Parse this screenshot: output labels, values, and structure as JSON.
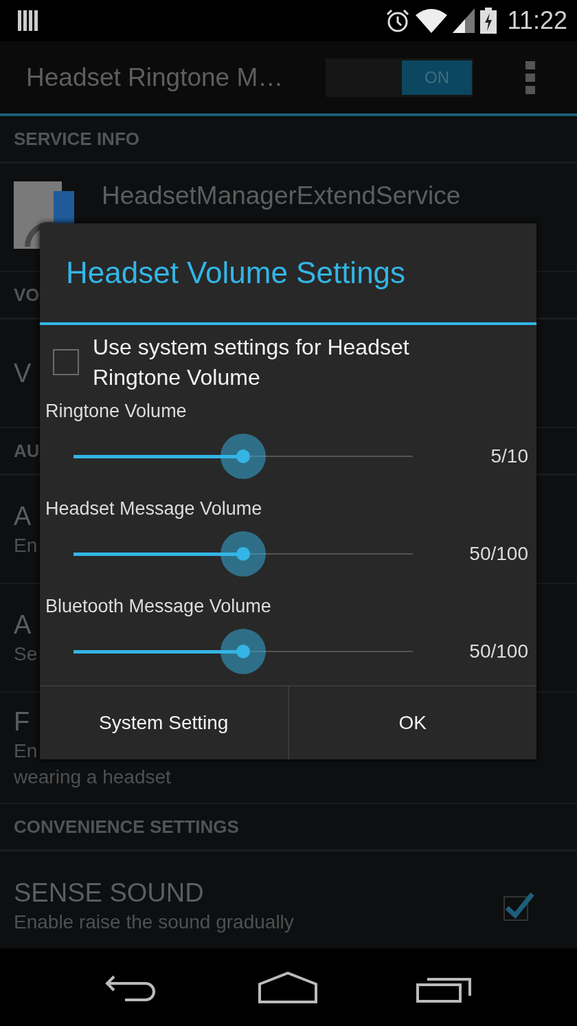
{
  "status_bar": {
    "time": "11:22"
  },
  "action_bar": {
    "title": "Headset Ringtone M…",
    "switch": {
      "label": "ON",
      "on": true
    }
  },
  "sections": [
    {
      "header": "SERVICE INFO",
      "items": [
        {
          "kind": "service",
          "title": "HeadsetManagerExtendService"
        }
      ]
    },
    {
      "header": "VO",
      "items": [
        {
          "kind": "plain",
          "title": "V"
        }
      ]
    },
    {
      "header": "AU",
      "items": [
        {
          "kind": "plain",
          "title": "A",
          "subtitle_lines": [
            "En"
          ]
        },
        {
          "kind": "plain",
          "title": "A",
          "subtitle_lines": [
            "Se"
          ]
        },
        {
          "kind": "plain",
          "title": "F",
          "subtitle_lines": [
            "En",
            "wearing a headset"
          ]
        }
      ]
    },
    {
      "header": "CONVENIENCE SETTINGS",
      "items": [
        {
          "kind": "check",
          "title": "SENSE SOUND",
          "subtitle_lines": [
            "Enable raise the sound gradually"
          ],
          "checked": true
        }
      ]
    }
  ],
  "dialog": {
    "title": "Headset Volume Settings",
    "checkbox": {
      "label": "Use system settings for Headset Ringtone Volume",
      "checked": false
    },
    "sliders": [
      {
        "label": "Ringtone Volume",
        "level": 0.5,
        "reading": "5/10"
      },
      {
        "label": "Headset Message Volume",
        "level": 0.5,
        "reading": "50/100"
      },
      {
        "label": "Bluetooth Message Volume",
        "level": 0.5,
        "reading": "50/100"
      }
    ],
    "buttons": [
      "System Setting",
      "OK"
    ]
  }
}
